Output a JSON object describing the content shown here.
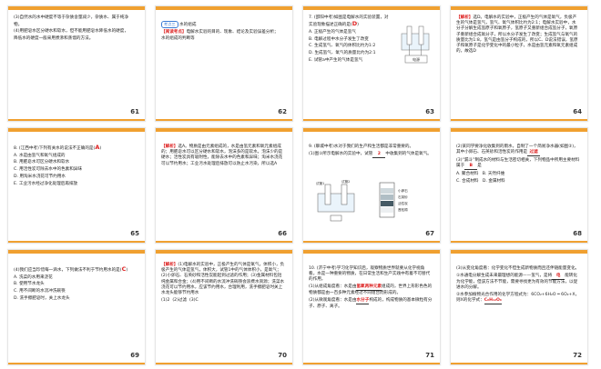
{
  "colors": {
    "accent": "#f0a030",
    "red": "#dd2222",
    "blue": "#3a7bd5"
  },
  "slides": [
    {
      "num": "61",
      "lines": [
        "(3)自然水的水中硬度不等于杂质含量减少，杂质水、属于纯净",
        "物。",
        "(4)用肥皂水区分硬水和软水，但不能用肥皂水降低水的硬度，",
        "降低水的硬度一般采用煮沸和蒸馏的方法。"
      ]
    },
    {
      "num": "62",
      "topic_badge": "考点三",
      "topic_title": "水的组成",
      "tag": "【阅读考点】",
      "lines": [
        "电解水实验的目的、现象、结论及实验误差分析；",
        "水的组成的判断等"
      ]
    },
    {
      "num": "63",
      "question": "7. (邵阳中考)如图是电解水的实验装置，对实验现象描述正确的是",
      "answer": "D",
      "options": [
        "A. 正极产生的气体是氢气",
        "B. 电解过程中水分子发生了改变",
        "C. 生成氢气、氧气的体积比约为1:2",
        "D. 生成氢气、氧气的质量比约为2:1",
        "E. 试管a中产生的气体是氢气"
      ],
      "device_label": "电源"
    },
    {
      "num": "64",
      "tag": "【解析】",
      "lines": [
        "选D。电解水的实验中，正极产生的气体是氧气，负极产生的气体是氢气，氢气、氧气体积比约为2:1；电解水实验中，水分子分解生成氢原子和氧原子，氢原子又重新组合成氢分子，氧原子重新组合成氧分子，所以水分子发生了改变；生成氢气与氧气的质量比为1:8，氢气是由氢分子构成的，所以C、D说法错误，氢原子和氧原子是化学变化中的最小粒子，水是由氢元素和氧元素组成的，故选D"
      ]
    },
    {
      "num": "65",
      "question": "8. (江西中考)下列有关水的说法不正确的是",
      "answer": "A",
      "options": [
        "A. 水是由氢气和氧气组成的",
        "B. 用肥皂水可区分硬水和软水",
        "C. 用活性炭可除去水中的色素和异味",
        "D. 用淘米水浇花可节约用水",
        "E. 工业污水经过净化处理后再排放"
      ]
    },
    {
      "num": "66",
      "tag": "【解析】",
      "lines": [
        "选A。物质是由元素组成的，水是由氢元素和氧元素组成的；用肥皂水可以区分硬水和软水，泡沫多的是软水，泡沫少的是硬水；活性炭具有吸附性，能除去水中的色素和异味；淘米水浇花可以节约用水；工业污水处理后排放可以防止水污染，所以选A"
      ]
    },
    {
      "num": "67",
      "question": "9. (聊城中考)水对于我们的生产和生活都是非常重要的。",
      "sub": "(1)图①所示电解水的实验中，试管",
      "sub_answer": "2",
      "sub_tail": "中收集到的气体是氧气。",
      "labels": [
        "试管1",
        "试管2",
        "活性炭",
        "小卵石",
        "石英砂",
        "蓬松棉"
      ]
    },
    {
      "num": "68",
      "lines": [
        "(2)某同学要净化收集到的雨水，自制了一个简易净水器(如图②)，其中小卵石、石英砂和活性炭的作用是"
      ],
      "answer1": "过滤",
      "lines2": [
        "(3)“漏斗”制成水的材料与生活密切相关，下列物品中所用主要材料属于",
        "是"
      ],
      "answer2": "B",
      "options": [
        "A. 聚合材料",
        "B. 天然纤维",
        "C. 合成材料",
        "D. 金属材料"
      ]
    },
    {
      "num": "69",
      "question": "(4)我们应当珍惜每一滴水，下列做法不利于节约用水的是",
      "answer": "C",
      "options": [
        "A. 洗菜的水用来浇花",
        "B. 使用节水龙头",
        "C. 用不间断的水流冲洗碗筷",
        "D. 洗手擦肥皂时，关上水龙头"
      ]
    },
    {
      "num": "70",
      "tag": "【解析】",
      "lines": [
        "(1)电解水的实验中，正极产生的气体是氧气，体积小，负极产生的气体是氢气，体积大，试管1中的气体体积小，是氧气；(2)小卵石、石英砂和活性炭能起到过滤的作用；(3)金属材料包括纯金属和合金；(4)用不间断的水流冲洗碗筷会浪费水资源；洗菜水浇花可以节约用水，应该节约用水，合理利用，洗手擦肥皂时关上水龙头能够节约用水"
      ],
      "answers": [
        "(1)2",
        "(2)过滤",
        "(3)C"
      ]
    },
    {
      "num": "71",
      "question": "10. (济宁中考)学习化学知识后，观察物质世界就要从化学视角看。水是一种重要的物质，在日常生活和生产实践中有着不可替代的作用，",
      "sub1": "(1)从组成角度看：水是由",
      "ans1": "氢氧两种元素",
      "sub1b": "组成的，世界上形形色色的物质都是由一百多种元素经过不同组合而形成的。",
      "sub2": "(2)从微观角度看：水是由",
      "ans2": "水分子",
      "sub2b": "构成的，构成物质的基本微粒有分子、原子、离子。"
    },
    {
      "num": "72",
      "lines": [
        "(3)从变化角度看：化学变化不但生成新物质而且还伴随能量变化。",
        "①水通电分解生成未来最理想的能源——氢气，是将",
        "能转化为化学能，但该方法不节能，需要寻找更为有效的节能方法，以促进水的分解。",
        "②水参加植物光合作用的化学方程式为：6CO₂+6H₂O ═ 6O₂+X，则X的化学式："
      ],
      "ans1": "电",
      "ans2": "C₆H₁₂O₆"
    }
  ]
}
